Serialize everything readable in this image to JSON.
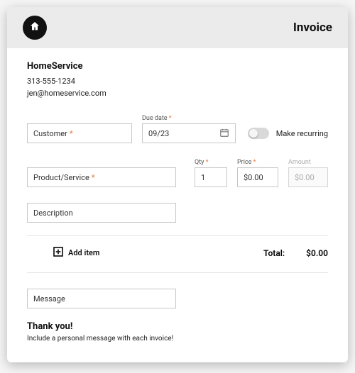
{
  "header": {
    "title": "Invoice"
  },
  "business": {
    "name": "HomeService",
    "phone": "313-555-1234",
    "email": "jen@homeservice.com"
  },
  "fields": {
    "customer_label": "Customer",
    "due_date_label": "Due date",
    "due_date_value": "09/23",
    "make_recurring_label": "Make recurring",
    "product_label": "Product/Service",
    "qty_label": "Qty",
    "qty_value": "1",
    "price_label": "Price",
    "price_value": "$0.00",
    "amount_label": "Amount",
    "amount_value": "$0.00",
    "description_label": "Description",
    "message_label": "Message"
  },
  "actions": {
    "add_item_label": "Add item"
  },
  "totals": {
    "label": "Total:",
    "value": "$0.00"
  },
  "footer": {
    "thanks_title": "Thank you!",
    "thanks_sub": "Include a personal message with each invoice!"
  }
}
